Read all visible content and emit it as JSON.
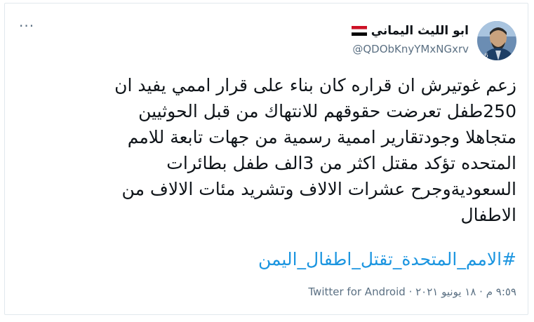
{
  "tweet": {
    "more_label": "···",
    "author": {
      "display_name": "ابو الليث اليماني",
      "handle": "@QDObKnyYMxNGxrv",
      "flag_icon": "yemen-flag-icon",
      "avatar_icon": "profile-avatar"
    },
    "text_lines": [
      "زعم غوتيرش ان قراره كان بناء على قرار اممي يفيد ان",
      "250طفل تعرضت حقوقهم للانتهاك من قبل الحوثيين",
      "متجاهلا وجودتقارير اممية رسمية من جهات تابعة للامم",
      "المتحده تؤكد مقتل اكثر من 3الف طفل بطائرات",
      "السعوديةوجرح عشرات الالاف وتشريد مئات الالاف من",
      "الاطفال"
    ],
    "hashtag": "#الامم_المتحدة_تقتل_اطفال_اليمن",
    "timestamp": "٩:٥٩ م · ١٨ يونيو ٢٠٢١",
    "separator": " · ",
    "source": "Twitter for Android"
  },
  "colors": {
    "link": "#1b95e0",
    "secondary_text": "#5b7083",
    "border": "#e1e8ed",
    "flag_red": "#ce1126",
    "flag_white": "#ffffff",
    "flag_black": "#000000"
  }
}
